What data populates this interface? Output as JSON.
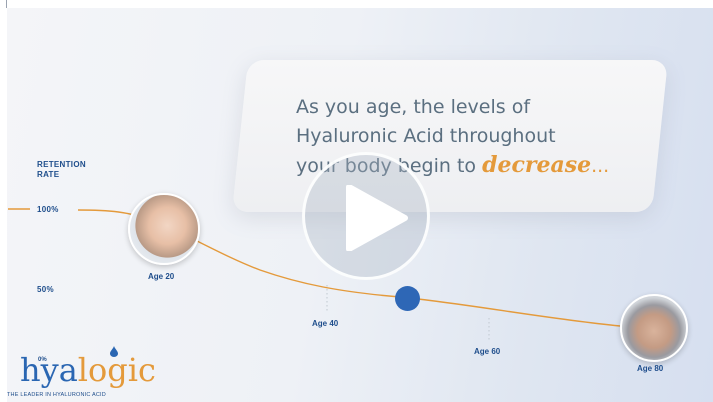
{
  "headline": {
    "line1": "As you age, the levels of",
    "line2": "Hyaluronic Acid throughout",
    "line3_prefix": "your body begin to ",
    "emphasis": "decrease",
    "ellipsis": "..."
  },
  "chart": {
    "retention_line1": "RETENTION",
    "retention_line2": "RATE",
    "y100": "100%",
    "y50": "50%",
    "ages": [
      "Age 20",
      "Age 40",
      "Age 60",
      "Age 80"
    ]
  },
  "logo": {
    "percent": "0%",
    "word_a": "hya",
    "word_b": "logic",
    "tagline": "THE LEADER IN HYALURONIC ACID"
  },
  "colors": {
    "accent": "#e49a3b",
    "brand": "#2a66b2",
    "text": "#5b6f80"
  },
  "icons": {
    "play": "play-icon"
  }
}
